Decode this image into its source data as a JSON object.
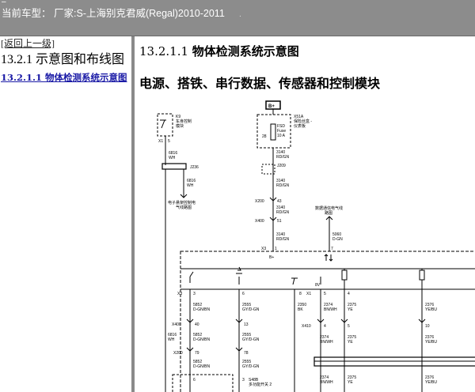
{
  "header": {
    "minimize_glyph": "–",
    "title": "当前车型： 厂家:S-上海别克君威(Regal)2010-2011",
    "dot": "."
  },
  "sidebar": {
    "back_label": "[返回上一级]",
    "section_title": "13.2.1 示意图和布线图",
    "link_label": "13.2.1.1 物体检测系统示意图"
  },
  "main": {
    "heading_number": "13.2.1.1 ",
    "heading_text": "物体检测系统示意图",
    "subheading": "电源、搭铁、串行数据、传感器和控制模块"
  },
  "diagram": {
    "k9": "K9",
    "k9_name": "车身控制",
    "k9_name2": "模块",
    "x1_top": "X1",
    "x1_top_pin": "5",
    "w6816a": "6816",
    "w6816a_c": "WH",
    "j236": "J236",
    "w6816b": "6816",
    "w6816b_c": "WH",
    "ref_left": "电子悬架控制电",
    "ref_left2": "气线路图",
    "bplus": "B+",
    "x51a": "X51A",
    "x51a_name": "保险丝盒 -",
    "x51a_name2": "仪表板",
    "fsd": "FSD",
    "fuse": "Fuse",
    "fuse_amp": "10 A",
    "fuse_pin": "28",
    "w3140a": "3140",
    "w3140a_c": "RD/GN",
    "j209": "J209",
    "w3140b": "3140",
    "w3140b_c": "RD/GN",
    "x200": "X200",
    "x200_pin": "43",
    "w3140c": "3140",
    "w3140c_c": "RD/GN",
    "x400": "X400",
    "x400_pin": "51",
    "w3140d": "3140",
    "w3140d_c": "RD/GN",
    "ref_right": "数据通信电气线",
    "ref_right2": "路图",
    "w5060": "5060",
    "w5060_c": "D-GN",
    "x3_top": "X3",
    "x3_pin1": "1",
    "x3_pin7": "7",
    "bplus_in": "B+",
    "x3_mid": "X3",
    "pin3": "3",
    "pin6": "6",
    "pin8": "8",
    "pin5": "5",
    "pin4": "4",
    "x1_mid": "X1",
    "v8": "8V",
    "w5852a": "5852",
    "w5852a_c": "D-GN/BN",
    "w2555a": "2555",
    "w2555a_c": "GY/D-GN",
    "w2350": "2350",
    "w2350_c": "BK",
    "w2374a": "2374",
    "w2374a_c": "BN/WH",
    "w2375a": "2375",
    "w2375a_c": "YE",
    "w2376a": "2376",
    "w2376a_c": "YE/BU",
    "x400b": "X400",
    "x400b_p1": "40",
    "x400b_p2": "13",
    "x410": "X410",
    "x410_p1": "4",
    "x410_p2": "5",
    "x410_p3": "10",
    "w6816c": "6816",
    "w6816c_c": "WH",
    "w5852b": "5852",
    "w5852b_c": "D-GN/BN",
    "w2555b": "2555",
    "w2555b_c": "GY/D-GN",
    "w2374b": "2374",
    "w2374b_c": "BN/WH",
    "w2375b": "2375",
    "w2375b_c": "YE",
    "w2376b": "2376",
    "w2376b_c": "YE/BU",
    "x200b": "X200",
    "x200b_p1": "79",
    "x200b_p2": "78",
    "w5852c": "5852",
    "w5852c_c": "D-GN/BN",
    "w2555c": "2555",
    "w2555c_c": "GY/D-GN",
    "w2374c": "2374",
    "w2374c_c": "BN/WH",
    "w2375c": "2375",
    "w2375c_c": "YE",
    "w2376c": "2376",
    "w2376c_c": "YE/BU",
    "s48b": "S48B",
    "s48b_name": "多功能开关 2",
    "bot_pin6": "6",
    "bot_pin3": "3"
  }
}
